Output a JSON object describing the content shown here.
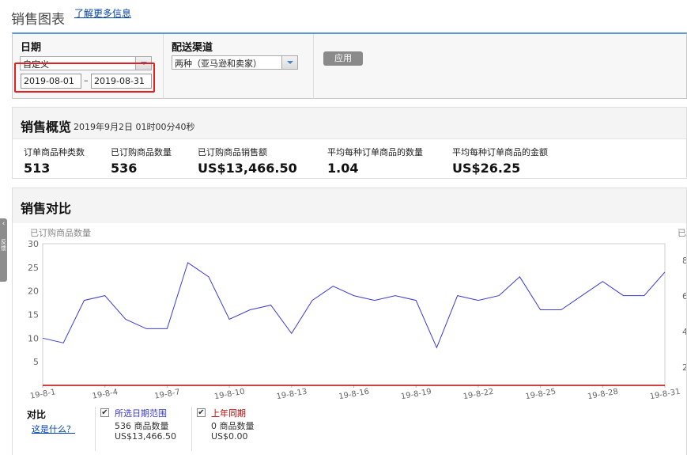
{
  "header": {
    "title": "销售图表",
    "learn_more": "了解更多信息"
  },
  "filters": {
    "date_label": "日期",
    "date_range_value": "自定义",
    "start_date": "2019-08-01",
    "date_separator": "–",
    "end_date": "2019-08-31",
    "channel_label": "配送渠道",
    "channel_value": "两种（亚马逊和卖家）",
    "apply_label": "应用"
  },
  "summary": {
    "title": "销售概览",
    "timestamp": "2019年9月2日 01时00分40秒",
    "metrics": [
      {
        "label": "订单商品种类数",
        "value": "513"
      },
      {
        "label": "已订购商品数量",
        "value": "536"
      },
      {
        "label": "已订购商品销售额",
        "value": "US$13,466.50"
      },
      {
        "label": "平均每种订单商品的数量",
        "value": "1.04"
      },
      {
        "label": "平均每种订单商品的金额",
        "value": "US$26.25"
      }
    ]
  },
  "comparison": {
    "title": "销售对比",
    "yaxis_left_label": "已订购商品数量",
    "yaxis_right_label": "已",
    "legend_title": "对比",
    "legend_help": "这是什么？",
    "legend": [
      {
        "name": "所选日期范围",
        "checked": "✔",
        "line1": "536 商品数量",
        "line2": "US$13,466.50",
        "color": "#3a3ad6"
      },
      {
        "name": "上年同期",
        "checked": "✔",
        "line1": "0 商品数量",
        "line2": "US$0.00",
        "color": "#c00000"
      }
    ]
  },
  "side_tab": {
    "chevron": "‹",
    "text": "反馈"
  },
  "chart_data": {
    "type": "line",
    "x": [
      "19-8-1",
      "19-8-2",
      "19-8-3",
      "19-8-4",
      "19-8-5",
      "19-8-6",
      "19-8-7",
      "19-8-8",
      "19-8-9",
      "19-8-10",
      "19-8-11",
      "19-8-12",
      "19-8-13",
      "19-8-14",
      "19-8-15",
      "19-8-16",
      "19-8-17",
      "19-8-18",
      "19-8-19",
      "19-8-20",
      "19-8-21",
      "19-8-22",
      "19-8-23",
      "19-8-24",
      "19-8-25",
      "19-8-26",
      "19-8-27",
      "19-8-28",
      "19-8-29",
      "19-8-30",
      "19-8-31"
    ],
    "tick_labels": [
      "19-8-1",
      "19-8-4",
      "19-8-7",
      "19-8-10",
      "19-8-13",
      "19-8-16",
      "19-8-19",
      "19-8-22",
      "19-8-25",
      "19-8-28",
      "19-8-31"
    ],
    "series": [
      {
        "name": "所选日期范围",
        "color": "#3a3ad6",
        "values": [
          10,
          9,
          18,
          19,
          14,
          12,
          12,
          26,
          23,
          14,
          16,
          17,
          11,
          18,
          21,
          19,
          18,
          19,
          18,
          8,
          19,
          18,
          19,
          23,
          16,
          16,
          19,
          22,
          19,
          19,
          24
        ]
      },
      {
        "name": "上年同期",
        "color": "#c00000",
        "values": [
          0,
          0,
          0,
          0,
          0,
          0,
          0,
          0,
          0,
          0,
          0,
          0,
          0,
          0,
          0,
          0,
          0,
          0,
          0,
          0,
          0,
          0,
          0,
          0,
          0,
          0,
          0,
          0,
          0,
          0,
          0
        ]
      }
    ],
    "ylabel": "已订购商品数量",
    "ylim": [
      0,
      30
    ],
    "yticks": [
      5,
      10,
      15,
      20,
      25,
      30
    ],
    "right_ticks": [
      "8",
      "6",
      "4",
      "2"
    ],
    "grid": false
  }
}
